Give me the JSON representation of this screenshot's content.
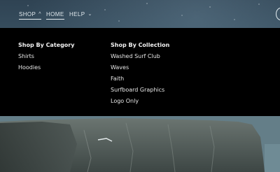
{
  "nav": {
    "items": [
      {
        "label": "SHOP",
        "chevron": "^"
      },
      {
        "label": "HOME"
      },
      {
        "label": "HELP",
        "chevron": "⌄"
      }
    ]
  },
  "mega_menu": {
    "columns": [
      {
        "heading": "Shop By Category",
        "links": [
          "Shirts",
          "Hoodies"
        ]
      },
      {
        "heading": "Shop By Collection",
        "links": [
          "Washed Surf Club",
          "Waves",
          "Faith",
          "Surfboard Graphics",
          "Logo Only"
        ]
      }
    ]
  },
  "icons": {
    "account": "account-icon"
  },
  "colors": {
    "menu_bg": "#000000",
    "nav_text": "#dfe7ec",
    "rock": "#5f6a66"
  }
}
